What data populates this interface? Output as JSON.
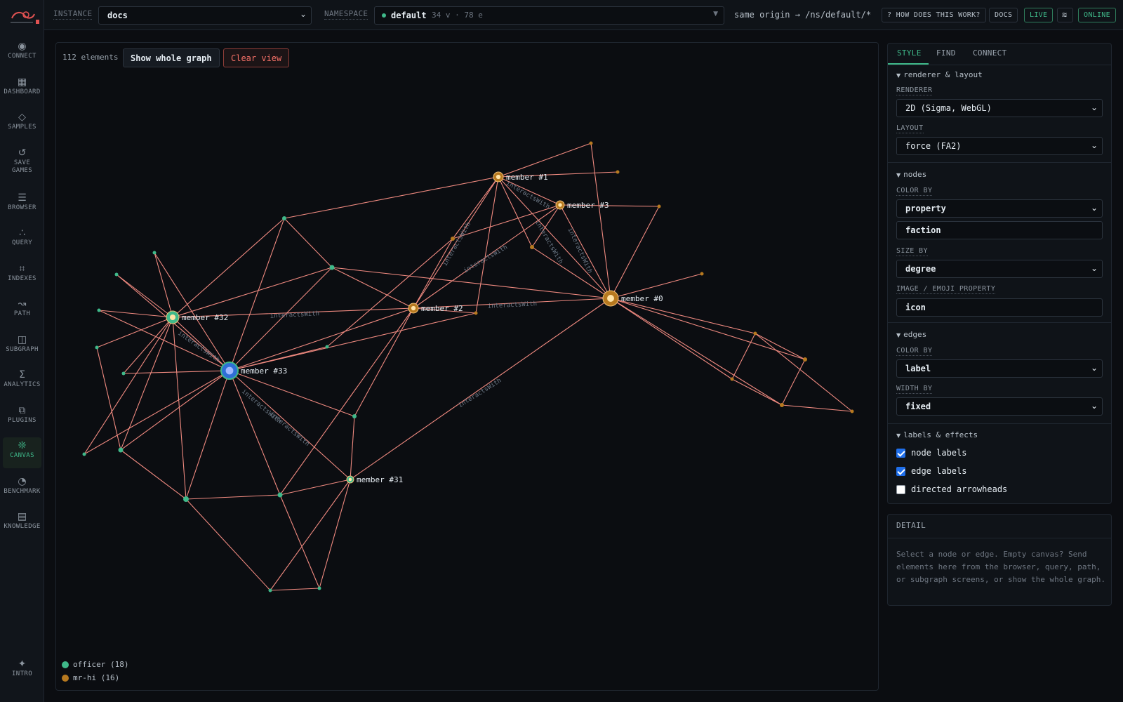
{
  "rail": {
    "items": [
      {
        "label": "CONNECT",
        "icon": "◉"
      },
      {
        "label": "DASHBOARD",
        "icon": "▦"
      },
      {
        "label": "SAMPLES",
        "icon": "◇"
      },
      {
        "label": "SAVE GAMES",
        "icon": "↺"
      },
      {
        "label": "BROWSER",
        "icon": "☰"
      },
      {
        "label": "QUERY",
        "icon": "∴"
      },
      {
        "label": "INDEXES",
        "icon": "⌗"
      },
      {
        "label": "PATH",
        "icon": "↝"
      },
      {
        "label": "SUBGRAPH",
        "icon": "◫"
      },
      {
        "label": "ANALYTICS",
        "icon": "Σ"
      },
      {
        "label": "PLUGINS",
        "icon": "⧉"
      },
      {
        "label": "CANVAS",
        "icon": "❊",
        "active": true
      },
      {
        "label": "BENCHMARK",
        "icon": "◔"
      },
      {
        "label": "KNOWLEDGE",
        "icon": "▤"
      }
    ],
    "intro": {
      "label": "INTRO",
      "icon": "✦"
    }
  },
  "topbar": {
    "instance_label": "INSTANCE",
    "instance_value": "docs",
    "namespace_label": "NAMESPACE",
    "namespace_value": "default",
    "namespace_counts": "34 v · 78 e",
    "origin_text": "same origin → /ns/default/*",
    "how_button": "? HOW DOES THIS WORK?",
    "docs_button": "DOCS",
    "live_button": "LIVE",
    "wave_button": "≋",
    "online_badge": "ONLINE"
  },
  "canvas": {
    "element_count": "112 elements",
    "show_whole_graph": "Show whole graph",
    "clear_view": "Clear view",
    "legend": [
      {
        "label": "officer (18)",
        "color": "#3fb98a"
      },
      {
        "label": "mr-hi (16)",
        "color": "#b7791f"
      }
    ],
    "node_labels": {
      "m0": "member #0",
      "m1": "member #1",
      "m2": "member #2",
      "m3": "member #3",
      "m31": "member #31",
      "m32": "member #32",
      "m33": "member #33"
    },
    "edge_label": "interactsWith"
  },
  "panel": {
    "tabs": [
      "STYLE",
      "FIND",
      "CONNECT"
    ],
    "renderer_section": "renderer & layout",
    "renderer_label": "RENDERER",
    "renderer_value": "2D (Sigma, WebGL)",
    "layout_label": "LAYOUT",
    "layout_value": "force (FA2)",
    "nodes_section": "nodes",
    "node_color_label": "COLOR BY",
    "node_color_value": "property",
    "node_color_property": "faction",
    "size_label": "SIZE BY",
    "size_value": "degree",
    "image_label": "IMAGE / EMOJI PROPERTY",
    "image_value": "icon",
    "edges_section": "edges",
    "edge_color_label": "COLOR BY",
    "edge_color_value": "label",
    "width_label": "WIDTH BY",
    "width_value": "fixed",
    "effects_section": "labels & effects",
    "node_labels_check": "node labels",
    "edge_labels_check": "edge labels",
    "arrowheads_check": "directed arrowheads",
    "node_labels_checked": true,
    "edge_labels_checked": true,
    "arrowheads_checked": false
  },
  "detail": {
    "title": "DETAIL",
    "text": "Select a node or edge. Empty canvas? Send elements here from the browser, query, path, or subgraph screens, or show the whole graph."
  },
  "colors": {
    "accent": "#3fb98a",
    "officer": "#3fb98a",
    "mr_hi": "#b7791f",
    "edge": "#f08a80",
    "danger": "#f47067"
  }
}
